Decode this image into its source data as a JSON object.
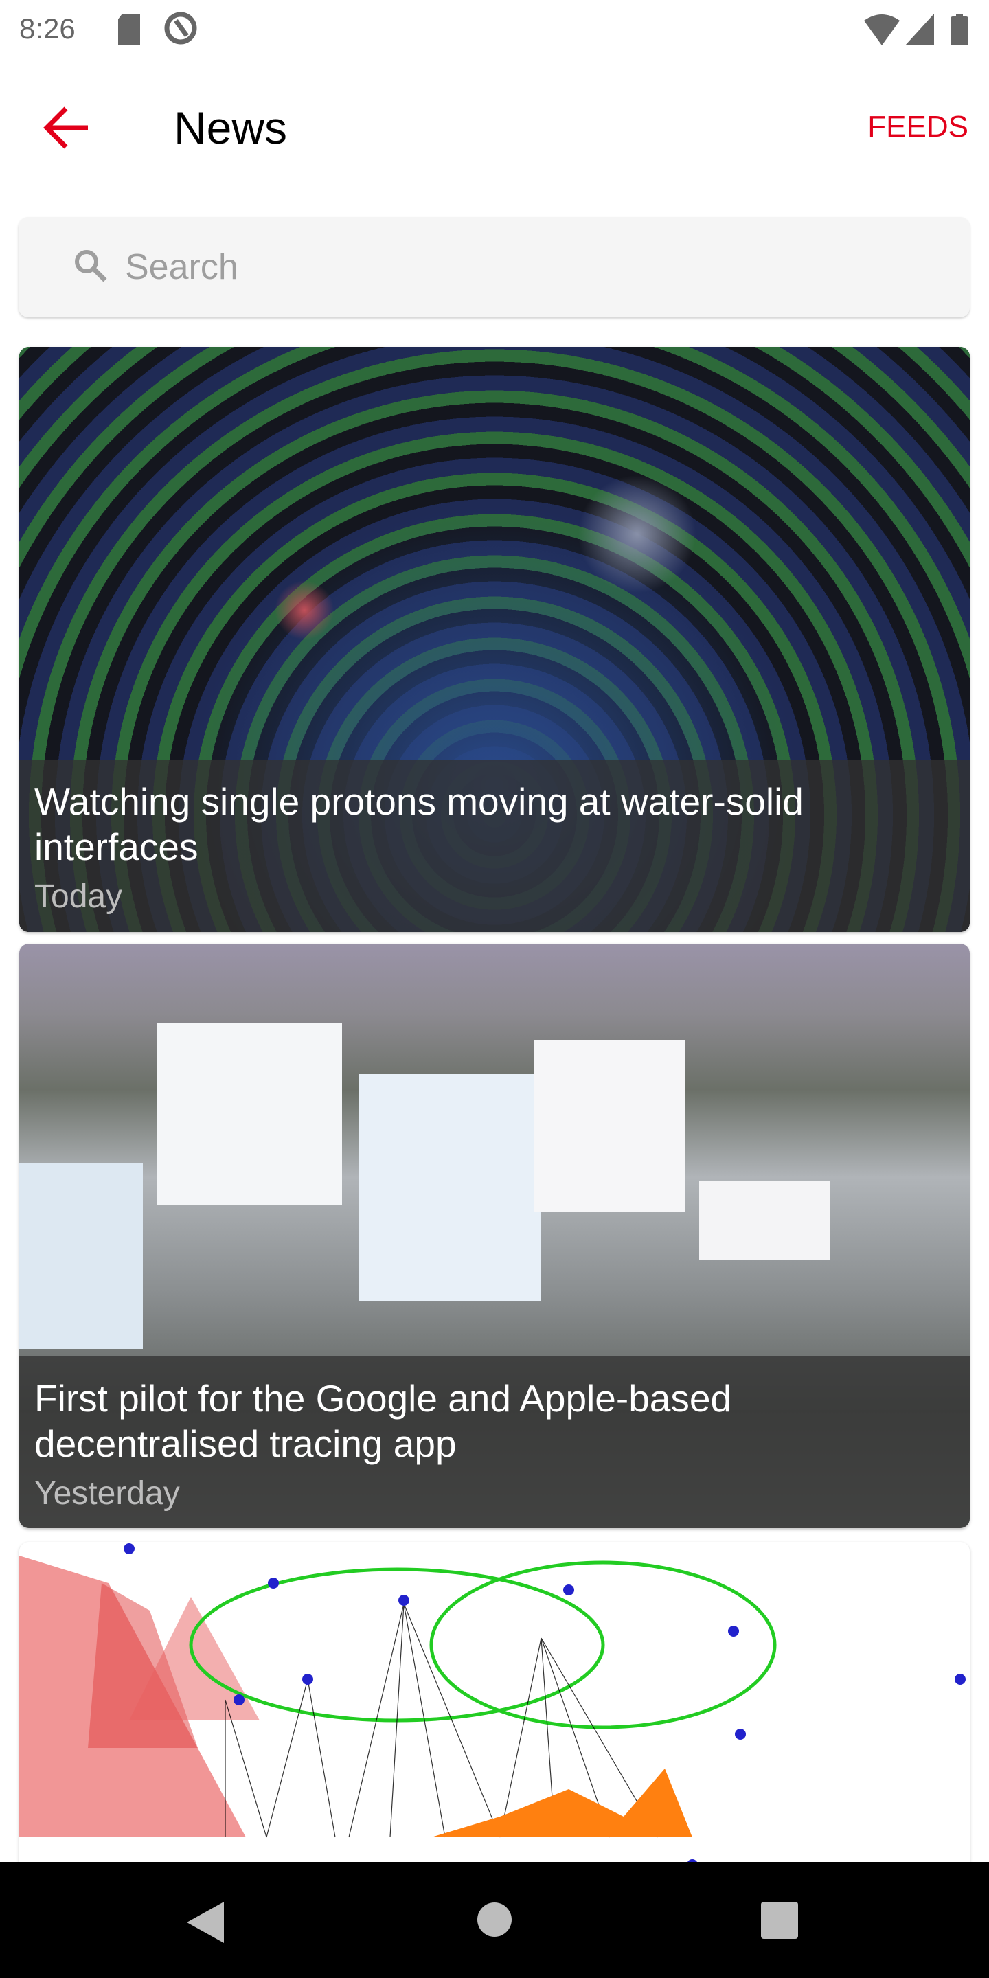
{
  "status_bar": {
    "time": "8:26",
    "icons": [
      "sd-card-icon",
      "at-sign-icon",
      "wifi-icon",
      "signal-icon",
      "battery-icon"
    ]
  },
  "header": {
    "title": "News",
    "action": "FEEDS",
    "back_icon": "arrow-left-icon"
  },
  "search": {
    "placeholder": "Search",
    "value": "",
    "icon": "search-icon"
  },
  "articles": [
    {
      "title": "Watching single protons moving at water-solid interfaces",
      "date": "Today"
    },
    {
      "title": "First pilot for the Google and Apple-based decentralised tracing app",
      "date": "Yesterday"
    },
    {
      "title": "",
      "date": ""
    }
  ],
  "colors": {
    "accent": "#e2001a"
  },
  "nav_bar": {
    "icons": [
      "back-triangle-icon",
      "home-circle-icon",
      "recents-square-icon"
    ]
  }
}
